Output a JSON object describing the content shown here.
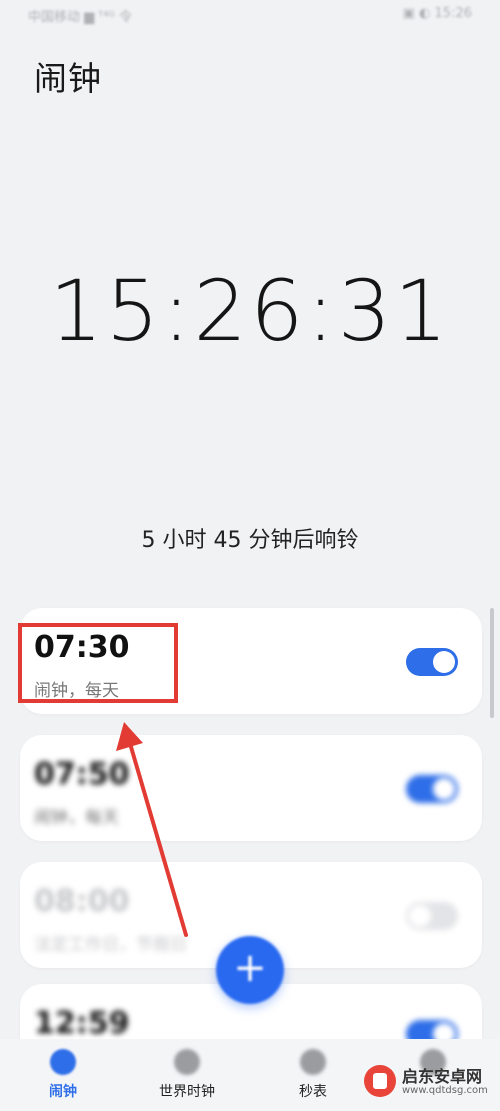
{
  "status_bar": {
    "left": "中国移动 ▆ ᵀ⁴ᴳ 令",
    "right": "▣ ◐ 15:26"
  },
  "page_title": "闹钟",
  "current_time": "15:26:31",
  "countdown": "5 小时 45 分钟后响铃",
  "alarms": [
    {
      "time": "07:30",
      "subtitle": "闹钟，每天",
      "enabled": true
    },
    {
      "time": "07:50",
      "subtitle": "闹钟，每天",
      "enabled": true
    },
    {
      "time": "08:00",
      "subtitle": "法定工作日，节假日",
      "enabled": false
    },
    {
      "time": "12:59",
      "subtitle": "",
      "enabled": true
    }
  ],
  "fab_label": "+",
  "bottom_nav": [
    {
      "label": "闹钟",
      "active": true
    },
    {
      "label": "世界时钟",
      "active": false
    },
    {
      "label": "秒表",
      "active": false
    },
    {
      "label": "",
      "active": false
    }
  ],
  "watermark": {
    "title": "启东安卓网",
    "url": "www.qdtdsg.com"
  },
  "colors": {
    "accent": "#2e6ee8",
    "annotation_red": "#e23b34",
    "background": "#f1f2f4"
  }
}
